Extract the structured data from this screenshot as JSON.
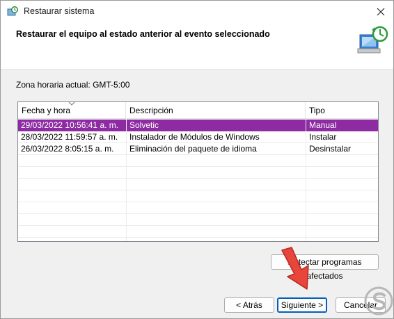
{
  "window": {
    "title": "Restaurar sistema"
  },
  "header": {
    "title": "Restaurar el equipo al estado anterior al evento seleccionado"
  },
  "timezone": {
    "label": "Zona horaria actual: GMT-5:00"
  },
  "table": {
    "columns": [
      "Fecha y hora",
      "Descripción",
      "Tipo"
    ],
    "rows": [
      {
        "date": "29/03/2022 10:56:41 a. m.",
        "description": "Solvetic",
        "type": "Manual",
        "selected": true
      },
      {
        "date": "28/03/2022 11:59:57 a. m.",
        "description": "Instalador de Módulos de Windows",
        "type": "Instalar",
        "selected": false
      },
      {
        "date": "26/03/2022 8:05:15 a. m.",
        "description": "Eliminación del paquete de idioma",
        "type": "Desinstalar",
        "selected": false
      }
    ]
  },
  "buttons": {
    "detect": "Detectar programas afectados",
    "back": "< Atrás",
    "next": "Siguiente >",
    "cancel": "Cancelar"
  },
  "colors": {
    "selection": "#8e2ba3",
    "annotation_arrow": "#e8453c",
    "focus": "#005fb8"
  },
  "icons": [
    "restore-app-icon",
    "close-icon",
    "sort-arrow-icon",
    "system-restore-graphic-icon",
    "red-arrow-annotation",
    "watermark-logo"
  ]
}
